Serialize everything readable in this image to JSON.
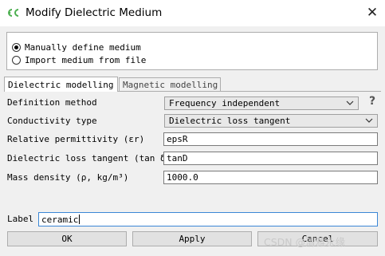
{
  "window": {
    "title": "Modify Dielectric Medium",
    "close_glyph": "✕"
  },
  "medium_source": {
    "options": [
      {
        "label": "Manually define medium",
        "selected": true
      },
      {
        "label": "Import medium from file",
        "selected": false
      }
    ]
  },
  "tabs": [
    {
      "label": "Dielectric modelling",
      "active": true
    },
    {
      "label": "Magnetic modelling",
      "active": false
    }
  ],
  "fields": {
    "definition_method": {
      "label": "Definition method",
      "value": "Frequency independent"
    },
    "conductivity_type": {
      "label": "Conductivity type",
      "value": "Dielectric loss tangent"
    },
    "relative_permittivity": {
      "label": "Relative permittivity (εr)",
      "value": "epsR"
    },
    "loss_tangent": {
      "label": "Dielectric loss tangent (tan δ)",
      "value": "tanD"
    },
    "mass_density": {
      "label": "Mass density (ρ, kg/m³)",
      "value": "1000.0"
    }
  },
  "help_glyph": "?",
  "name_label": "Label",
  "name_value": "ceramic",
  "buttons": {
    "ok": "OK",
    "apply": "Apply",
    "cancel": "Cancel"
  },
  "watermark": "CSDN @清雅永缘",
  "colors": {
    "focus_border": "#3b87d6",
    "icon_green": "#4caf50"
  },
  "icons": {
    "app": "cadfeko-logo-icon",
    "dropdown": "chevron-down-icon",
    "help": "question-mark-icon"
  }
}
